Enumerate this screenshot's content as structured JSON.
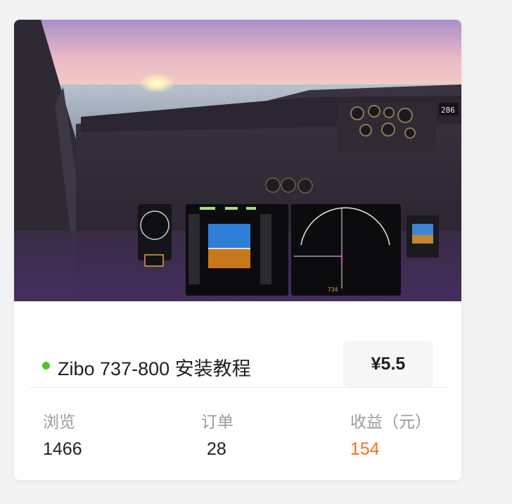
{
  "product": {
    "title": "Zibo 737-800 安装教程",
    "price": "¥5.5",
    "status_color": "#52c41a",
    "cover_text": {
      "readout": "286",
      "hdg": "734"
    }
  },
  "stats": {
    "views": {
      "label": "浏览",
      "value": "1466"
    },
    "orders": {
      "label": "订单",
      "value": "28"
    },
    "revenue": {
      "label": "收益（元）",
      "value": "154",
      "color": "#fa6d1c"
    }
  },
  "colors": {
    "page_background": "#f3f3f4",
    "card_background": "#ffffff",
    "text_primary": "#1f1f1f",
    "text_muted": "#9a9a9f"
  }
}
